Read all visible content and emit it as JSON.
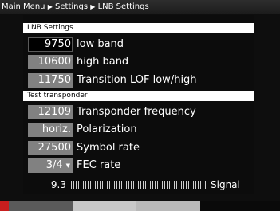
{
  "breadcrumb": [
    "Main Menu",
    "Settings",
    "LNB Settings"
  ],
  "lnb_section": {
    "title": "LNB Settings",
    "rows": [
      {
        "value": "_9750",
        "label": "low band",
        "selected": true
      },
      {
        "value": "10600",
        "label": "high band"
      },
      {
        "value": "11750",
        "label": "Transition LOF low/high"
      }
    ]
  },
  "transponder_section": {
    "title": "Test transponder",
    "rows": [
      {
        "value": "12109",
        "label": "Transponder frequency"
      },
      {
        "value": "horiz.",
        "label": "Polarization"
      },
      {
        "value": "27500",
        "label": "Symbol rate"
      },
      {
        "value": "3/4",
        "label": "FEC rate",
        "dropdown": true
      }
    ]
  },
  "signal": {
    "value": "9.3",
    "label": "Signal",
    "level": 0.93
  },
  "colors": {
    "breadcrumb_bg": "#2a2a2a",
    "section_bg": "#ffffff",
    "value_bg": "#818181",
    "color_keys": [
      "#c81e1e",
      "#5a5a5a",
      "#c8c8c8",
      "#b9b9b9"
    ]
  }
}
